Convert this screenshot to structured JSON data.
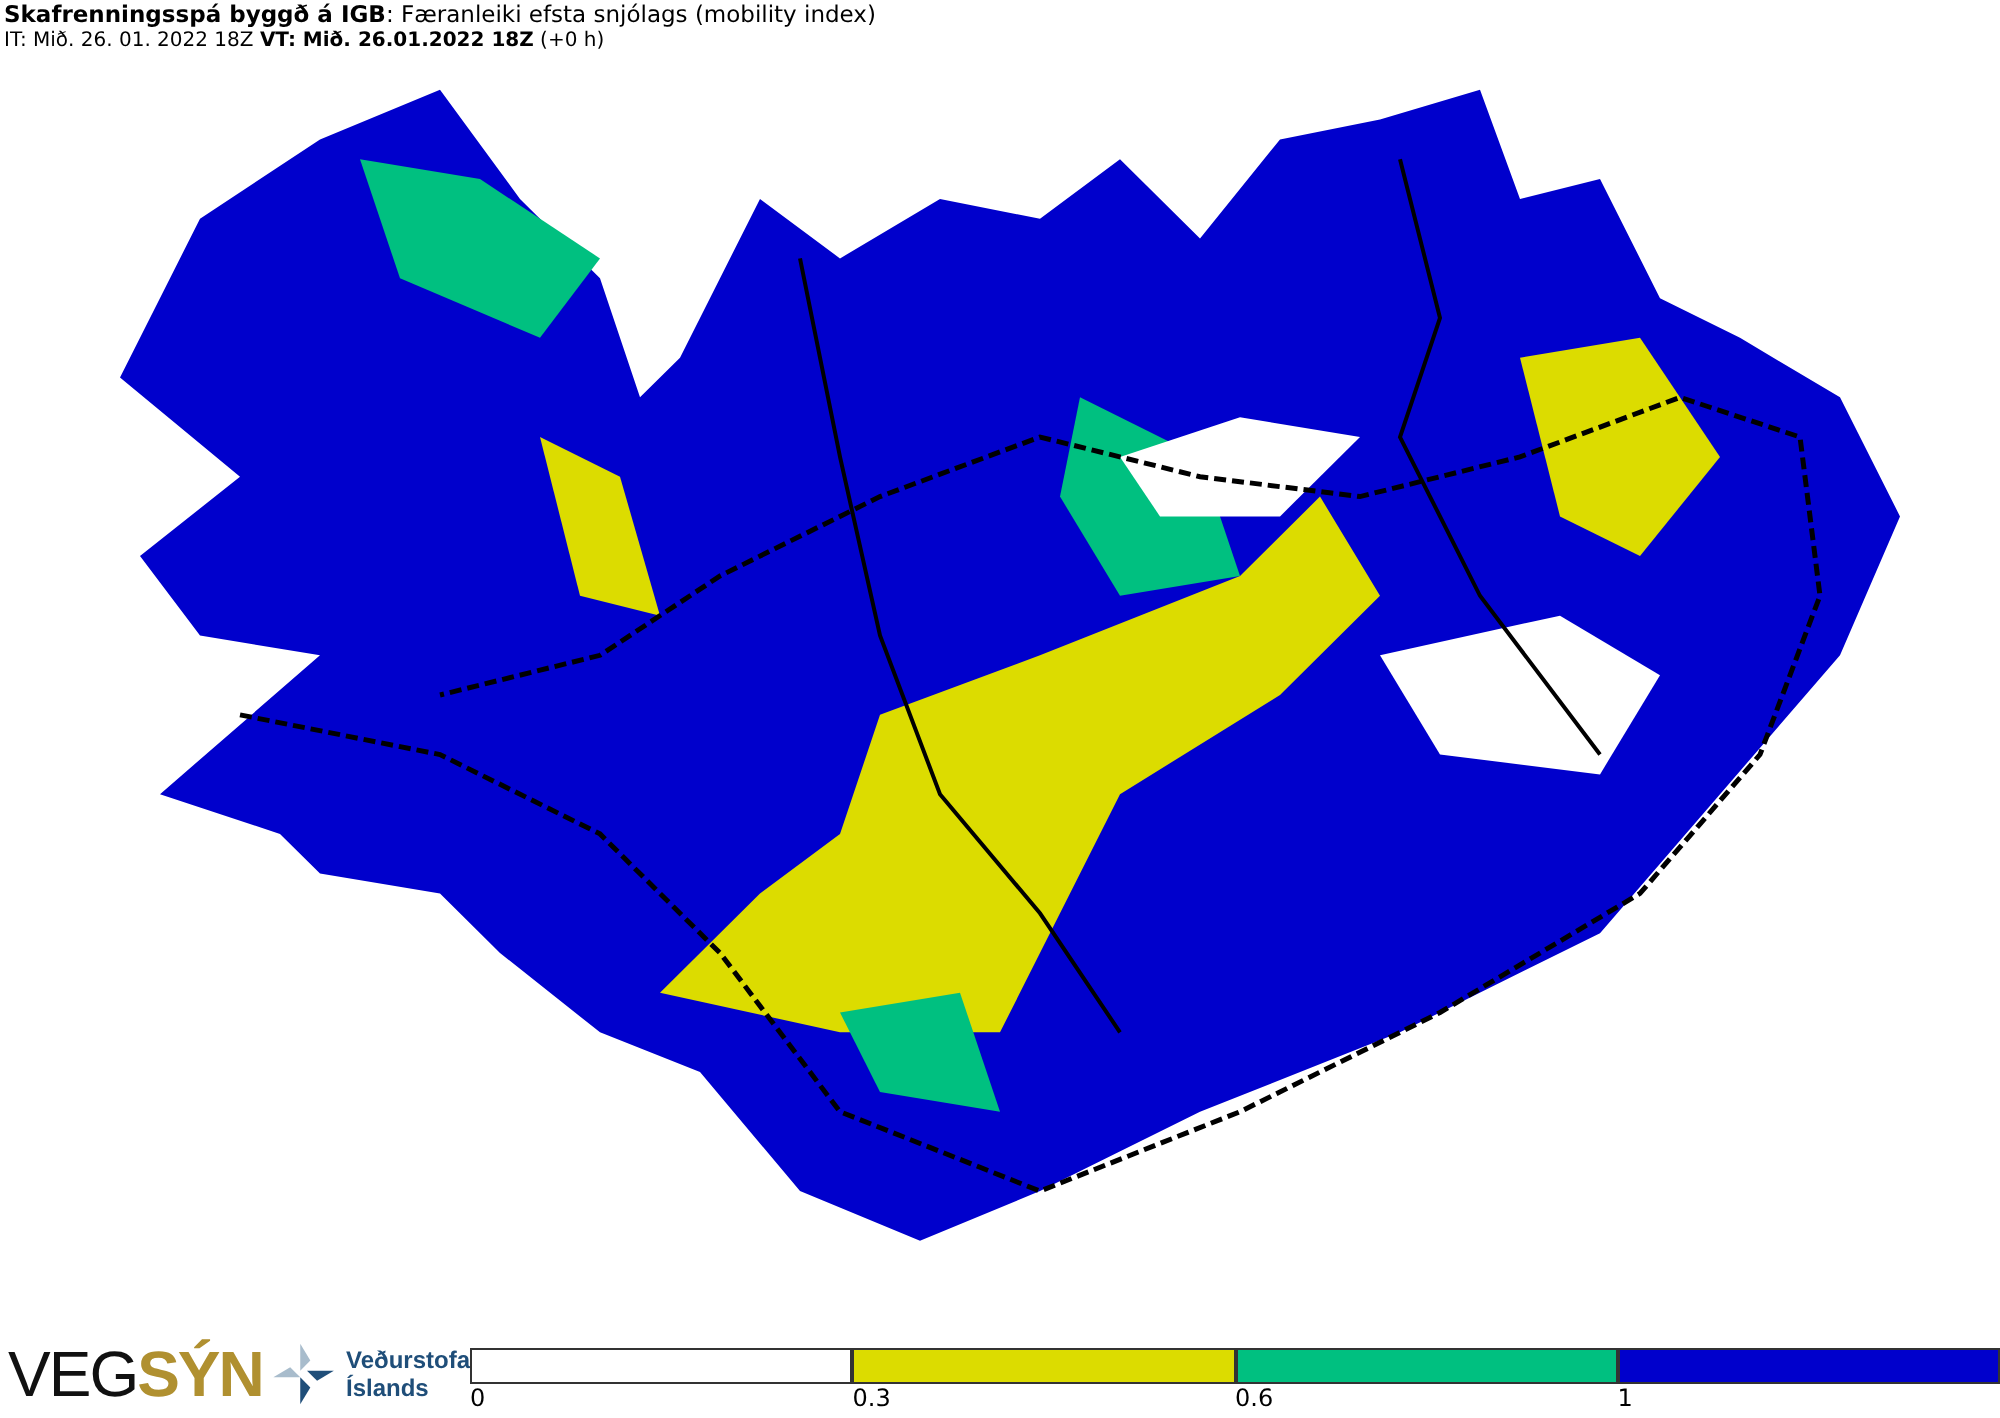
{
  "header": {
    "title": "**Skafrenningsspá byggð á IGB**: Færanleiki efsta snjólags (mobility index)",
    "times": "IT: Mið. 26. 01. 2022 18Z **VT: Mið. 26.01.2022 18Z** (+0 h)"
  },
  "logo": {
    "part_1": "VEG",
    "part_2": "SÝN",
    "agency_line_1": "Veðurstofa",
    "agency_line_2": "Íslands"
  },
  "legend": [
    {
      "label": "0",
      "color": "#ffffff"
    },
    {
      "label": "0.3",
      "color": "#dcdc00"
    },
    {
      "label": "0.6",
      "color": "#00c080"
    },
    {
      "label": "1",
      "color": "#0000cc"
    }
  ]
}
